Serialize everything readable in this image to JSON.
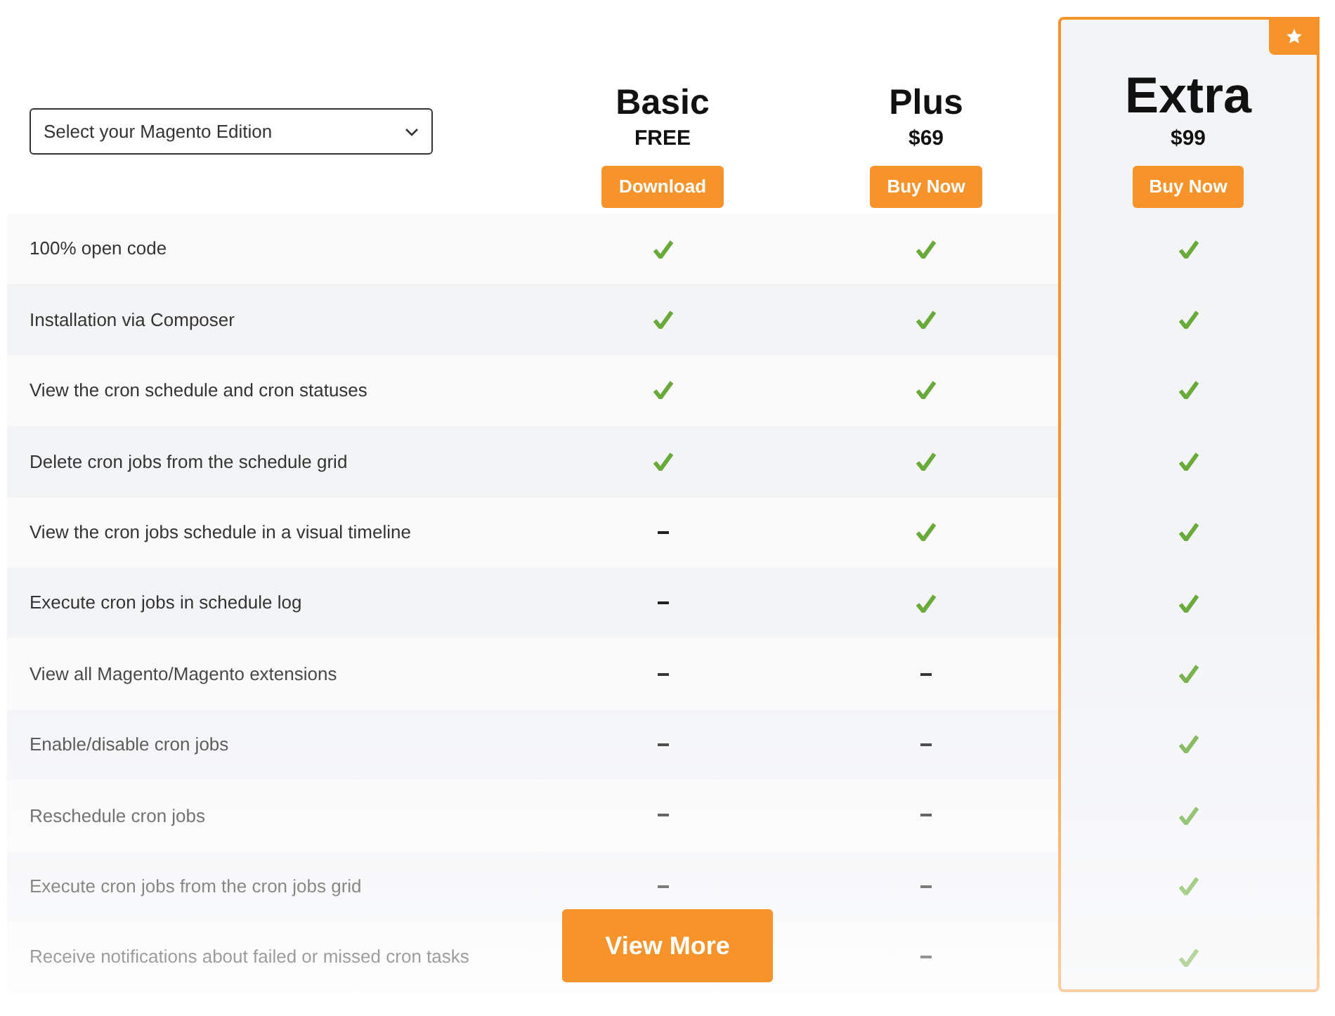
{
  "edition_select": {
    "placeholder": "Select your Magento Edition"
  },
  "plans": [
    {
      "name": "Basic",
      "price": "FREE",
      "button": "Download",
      "featured": false
    },
    {
      "name": "Plus",
      "price": "$69",
      "button": "Buy Now",
      "featured": false
    },
    {
      "name": "Extra",
      "price": "$99",
      "button": "Buy Now",
      "featured": true
    }
  ],
  "features": [
    {
      "label": "100% open code",
      "basic": true,
      "plus": true,
      "extra": true
    },
    {
      "label": "Installation via Composer",
      "basic": true,
      "plus": true,
      "extra": true
    },
    {
      "label": "View the cron schedule and cron statuses",
      "basic": true,
      "plus": true,
      "extra": true
    },
    {
      "label": "Delete cron jobs from the schedule grid",
      "basic": true,
      "plus": true,
      "extra": true
    },
    {
      "label": "View the cron jobs schedule in a visual timeline",
      "basic": false,
      "plus": true,
      "extra": true
    },
    {
      "label": "Execute cron jobs in schedule log",
      "basic": false,
      "plus": true,
      "extra": true
    },
    {
      "label": "View all Magento/Magento extensions",
      "basic": false,
      "plus": false,
      "extra": true
    },
    {
      "label": "Enable/disable cron jobs",
      "basic": false,
      "plus": false,
      "extra": true
    },
    {
      "label": "Reschedule cron jobs",
      "basic": false,
      "plus": false,
      "extra": true
    },
    {
      "label": "Execute cron jobs from the cron jobs grid",
      "basic": false,
      "plus": false,
      "extra": true
    },
    {
      "label": "Receive notifications about failed or missed cron tasks",
      "plus": false,
      "extra": true
    }
  ],
  "view_more_button": "View More"
}
